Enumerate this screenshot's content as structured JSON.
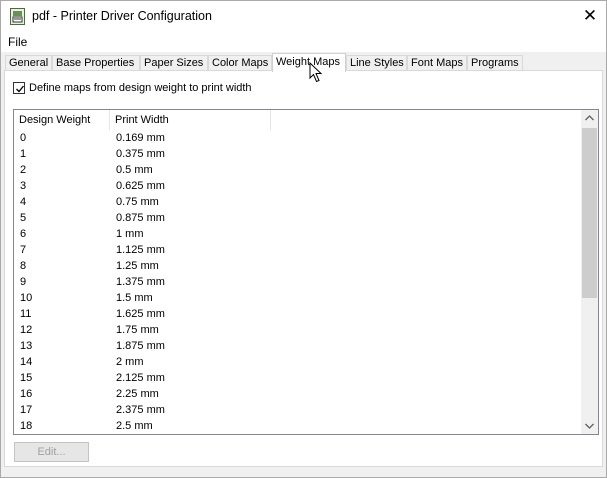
{
  "window": {
    "title": "pdf - Printer Driver Configuration",
    "close_label": "✕",
    "app_icon": "printer-icon"
  },
  "menu": {
    "items": [
      {
        "label": "File"
      }
    ]
  },
  "tabs": [
    {
      "label": "General",
      "active": false
    },
    {
      "label": "Base Properties",
      "active": false
    },
    {
      "label": "Paper Sizes",
      "active": false
    },
    {
      "label": "Color Maps",
      "active": false
    },
    {
      "label": "Weight Maps",
      "active": true
    },
    {
      "label": "Line Styles",
      "active": false
    },
    {
      "label": "Font Maps",
      "active": false
    },
    {
      "label": "Programs",
      "active": false
    }
  ],
  "weight_maps": {
    "checkbox": {
      "label": "Define maps from design weight to print width",
      "checked": true
    },
    "columns": [
      "Design Weight",
      "Print Width"
    ],
    "rows": [
      [
        "0",
        "0.169 mm"
      ],
      [
        "1",
        "0.375 mm"
      ],
      [
        "2",
        "0.5 mm"
      ],
      [
        "3",
        "0.625 mm"
      ],
      [
        "4",
        "0.75 mm"
      ],
      [
        "5",
        "0.875 mm"
      ],
      [
        "6",
        "1 mm"
      ],
      [
        "7",
        "1.125 mm"
      ],
      [
        "8",
        "1.25 mm"
      ],
      [
        "9",
        "1.375 mm"
      ],
      [
        "10",
        "1.5 mm"
      ],
      [
        "11",
        "1.625 mm"
      ],
      [
        "12",
        "1.75 mm"
      ],
      [
        "13",
        "1.875 mm"
      ],
      [
        "14",
        "2 mm"
      ],
      [
        "15",
        "2.125 mm"
      ],
      [
        "16",
        "2.25 mm"
      ],
      [
        "17",
        "2.375 mm"
      ],
      [
        "18",
        "2.5 mm"
      ]
    ],
    "edit_button": {
      "label": "Edit...",
      "enabled": false
    }
  },
  "colors": {
    "tab_border": "#d9d9d9",
    "list_border": "#828790",
    "scroll_thumb": "#cdcdcd"
  }
}
